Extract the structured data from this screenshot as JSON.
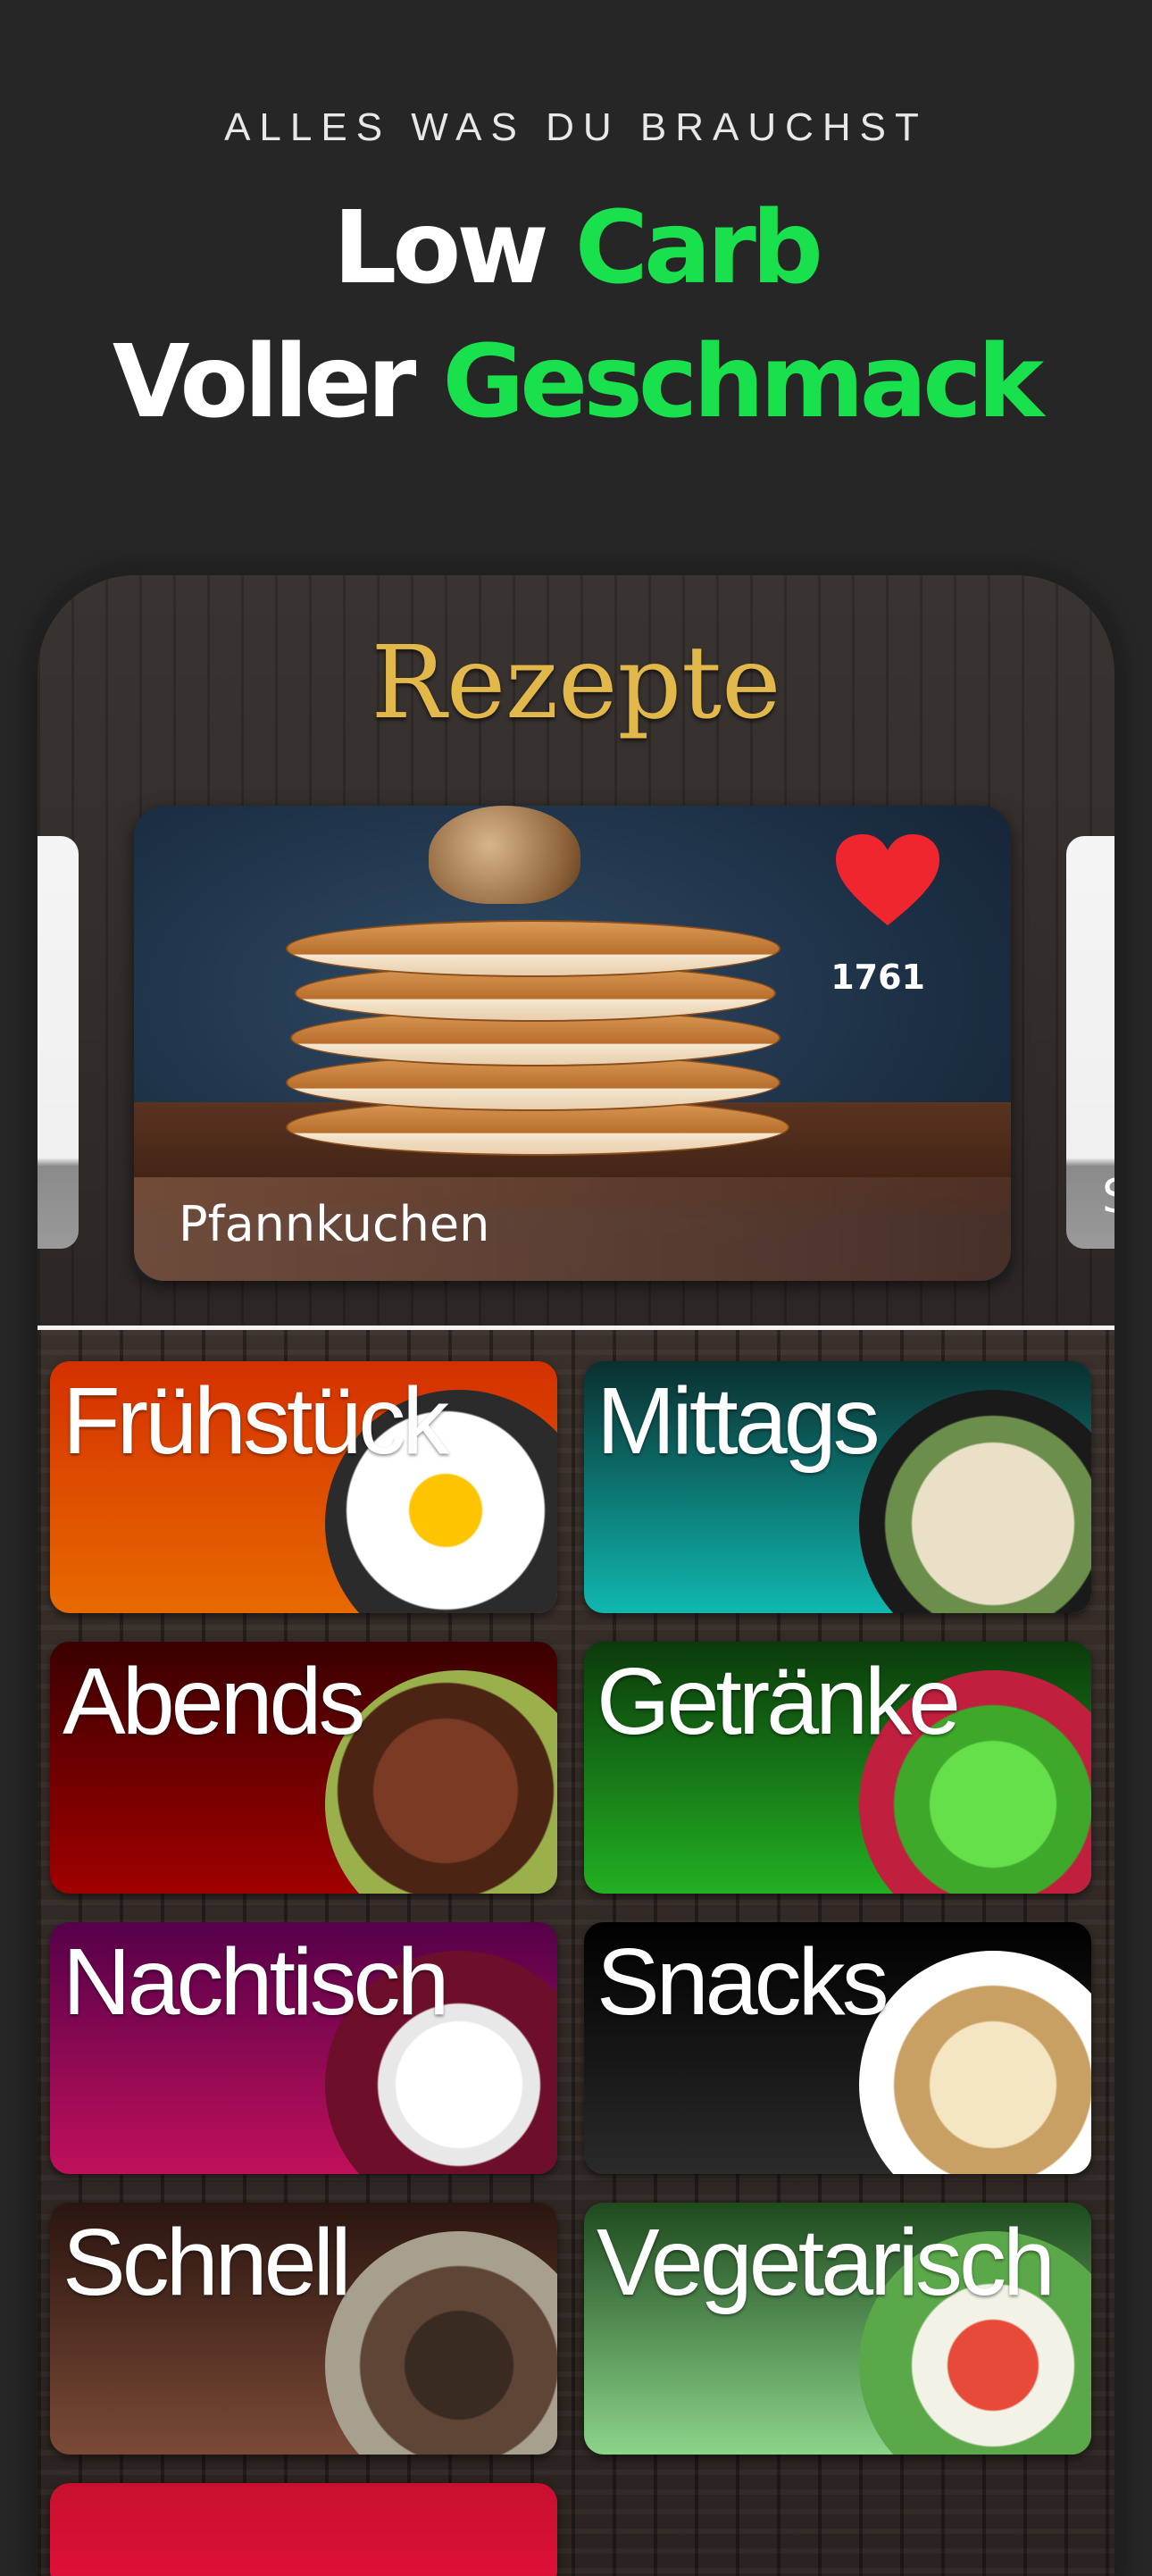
{
  "promo": {
    "kicker": "ALLES WAS DU BRAUCHST",
    "line1_white": "Low",
    "line1_green": "Carb",
    "line2_white": "Voller",
    "line2_green": "Geschmack"
  },
  "app": {
    "title": "Rezepte",
    "featured": {
      "name": "Pfannkuchen",
      "likes": "1761",
      "icon": "heart-icon"
    },
    "side_card_right_letter": "S",
    "categories": [
      {
        "label": "Frühstück"
      },
      {
        "label": "Mittags"
      },
      {
        "label": "Abends"
      },
      {
        "label": "Getränke"
      },
      {
        "label": "Nachtisch"
      },
      {
        "label": "Snacks"
      },
      {
        "label": "Schnell"
      },
      {
        "label": "Vegetarisch"
      }
    ]
  },
  "colors": {
    "accent_green": "#19e04d",
    "title_gold": "#e3b84a",
    "heart_red": "#f0262e"
  }
}
